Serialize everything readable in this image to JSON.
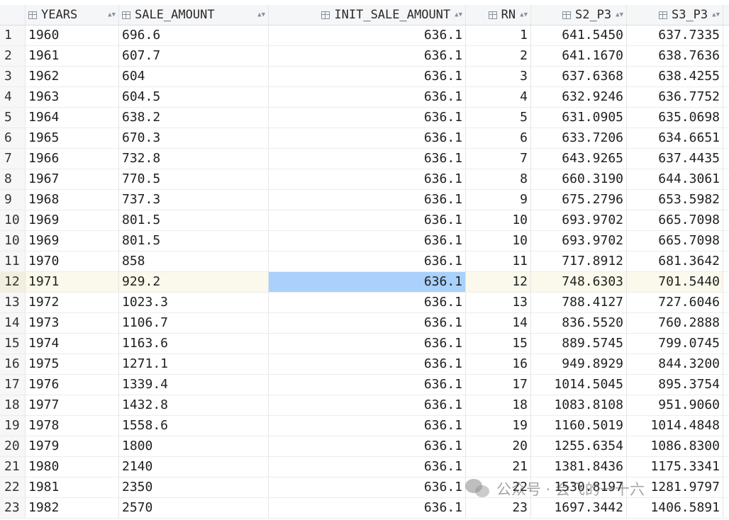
{
  "columns": {
    "years": "YEARS",
    "sale_amount": "SALE_AMOUNT",
    "init_sale_amount": "INIT_SALE_AMOUNT",
    "rn": "RN",
    "s2_p3": "S2_P3",
    "s3_p3": "S3_P3"
  },
  "selected_row_index": 12,
  "rows": [
    {
      "n": "1",
      "years": "1960",
      "sale": "696.6",
      "init": "636.1",
      "rn": "1",
      "s2": "641.5450",
      "s3": "637.7335"
    },
    {
      "n": "2",
      "years": "1961",
      "sale": "607.7",
      "init": "636.1",
      "rn": "2",
      "s2": "641.1670",
      "s3": "638.7636"
    },
    {
      "n": "3",
      "years": "1962",
      "sale": "604",
      "init": "636.1",
      "rn": "3",
      "s2": "637.6368",
      "s3": "638.4255"
    },
    {
      "n": "4",
      "years": "1963",
      "sale": "604.5",
      "init": "636.1",
      "rn": "4",
      "s2": "632.9246",
      "s3": "636.7752"
    },
    {
      "n": "5",
      "years": "1964",
      "sale": "638.2",
      "init": "636.1",
      "rn": "5",
      "s2": "631.0905",
      "s3": "635.0698"
    },
    {
      "n": "6",
      "years": "1965",
      "sale": "670.3",
      "init": "636.1",
      "rn": "6",
      "s2": "633.7206",
      "s3": "634.6651"
    },
    {
      "n": "7",
      "years": "1966",
      "sale": "732.8",
      "init": "636.1",
      "rn": "7",
      "s2": "643.9265",
      "s3": "637.4435"
    },
    {
      "n": "8",
      "years": "1967",
      "sale": "770.5",
      "init": "636.1",
      "rn": "8",
      "s2": "660.3190",
      "s3": "644.3061"
    },
    {
      "n": "9",
      "years": "1968",
      "sale": "737.3",
      "init": "636.1",
      "rn": "9",
      "s2": "675.2796",
      "s3": "653.5982"
    },
    {
      "n": "10",
      "years": "1969",
      "sale": "801.5",
      "init": "636.1",
      "rn": "10",
      "s2": "693.9702",
      "s3": "665.7098"
    },
    {
      "n": "10",
      "years": "1969",
      "sale": "801.5",
      "init": "636.1",
      "rn": "10",
      "s2": "693.9702",
      "s3": "665.7098"
    },
    {
      "n": "11",
      "years": "1970",
      "sale": "858",
      "init": "636.1",
      "rn": "11",
      "s2": "717.8912",
      "s3": "681.3642"
    },
    {
      "n": "12",
      "years": "1971",
      "sale": "929.2",
      "init": "636.1",
      "rn": "12",
      "s2": "748.6303",
      "s3": "701.5440"
    },
    {
      "n": "13",
      "years": "1972",
      "sale": "1023.3",
      "init": "636.1",
      "rn": "13",
      "s2": "788.4127",
      "s3": "727.6046"
    },
    {
      "n": "14",
      "years": "1973",
      "sale": "1106.7",
      "init": "636.1",
      "rn": "14",
      "s2": "836.5520",
      "s3": "760.2888"
    },
    {
      "n": "15",
      "years": "1974",
      "sale": "1163.6",
      "init": "636.1",
      "rn": "15",
      "s2": "889.5745",
      "s3": "799.0745"
    },
    {
      "n": "16",
      "years": "1975",
      "sale": "1271.1",
      "init": "636.1",
      "rn": "16",
      "s2": "949.8929",
      "s3": "844.3200"
    },
    {
      "n": "17",
      "years": "1976",
      "sale": "1339.4",
      "init": "636.1",
      "rn": "17",
      "s2": "1014.5045",
      "s3": "895.3754"
    },
    {
      "n": "18",
      "years": "1977",
      "sale": "1432.8",
      "init": "636.1",
      "rn": "18",
      "s2": "1083.8108",
      "s3": "951.9060"
    },
    {
      "n": "19",
      "years": "1978",
      "sale": "1558.6",
      "init": "636.1",
      "rn": "19",
      "s2": "1160.5019",
      "s3": "1014.4848"
    },
    {
      "n": "20",
      "years": "1979",
      "sale": "1800",
      "init": "636.1",
      "rn": "20",
      "s2": "1255.6354",
      "s3": "1086.8300"
    },
    {
      "n": "21",
      "years": "1980",
      "sale": "2140",
      "init": "636.1",
      "rn": "21",
      "s2": "1381.8436",
      "s3": "1175.3341"
    },
    {
      "n": "22",
      "years": "1981",
      "sale": "2350",
      "init": "636.1",
      "rn": "22",
      "s2": "1530.8197",
      "s3": "1281.9797"
    },
    {
      "n": "23",
      "years": "1982",
      "sale": "2570",
      "init": "636.1",
      "rn": "23",
      "s2": "1697.3442",
      "s3": "1406.5891"
    }
  ],
  "watermark": {
    "icon": "wechat-icon",
    "text": "公众号 · 会飞的一十六"
  },
  "colors": {
    "selected_row_bg": "#fbf8ec",
    "selected_cell_bg": "#a9d1fb",
    "header_bg": "#f5f6f8"
  }
}
